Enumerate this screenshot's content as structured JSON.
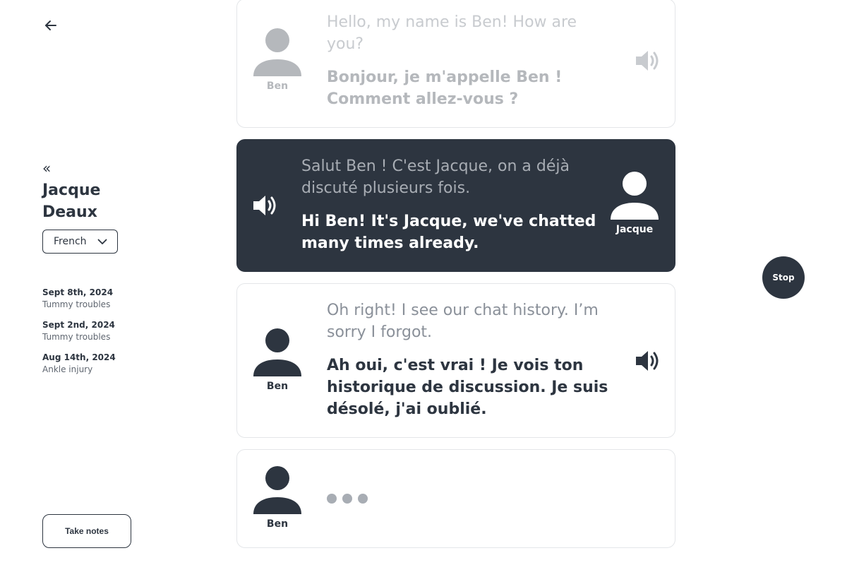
{
  "patient": {
    "name": "Jacque Deaux",
    "language": "French"
  },
  "nav": {
    "collapse_glyph": "«"
  },
  "history": [
    {
      "date": "Sept 8th, 2024",
      "topic": "Tummy troubles"
    },
    {
      "date": "Sept 2nd, 2024",
      "topic": "Tummy troubles"
    },
    {
      "date": "Aug 14th, 2024",
      "topic": "Ankle injury"
    }
  ],
  "actions": {
    "take_notes": "Take notes",
    "stop": "Stop"
  },
  "messages": [
    {
      "speaker": "Ben",
      "original": "Hello, my name is Ben! How are you?",
      "translation": "Bonjour, je m'appelle Ben ! Comment allez-vous ?"
    },
    {
      "speaker": "Jacque",
      "original": "Salut Ben ! C'est Jacque, on a déjà discuté plusieurs fois.",
      "translation": "Hi Ben! It's Jacque, we've chatted many times already."
    },
    {
      "speaker": "Ben",
      "original": "Oh right! I see our chat history. I’m sorry I forgot.",
      "translation": "Ah oui, c'est vrai ! Je vois ton historique de discussion. Je suis désolé, j'ai oublié."
    },
    {
      "speaker": "Ben",
      "status": "typing"
    }
  ],
  "icons": {
    "back": "arrow-left-icon",
    "collapse": "double-chevron-left-icon",
    "dropdown": "chevron-down-icon",
    "avatar": "user-icon",
    "speaker": "speaker-icon"
  },
  "colors": {
    "primary": "#2d3540",
    "muted": "#b5b8bc",
    "border": "#e4e6e9"
  }
}
